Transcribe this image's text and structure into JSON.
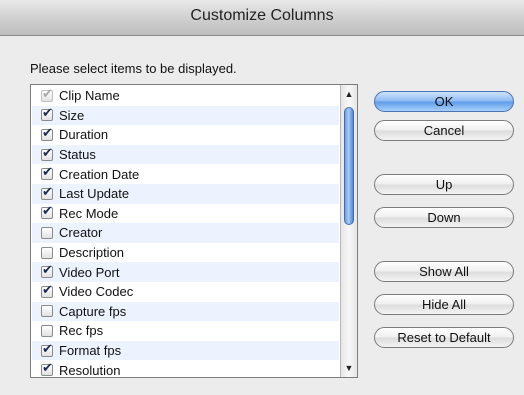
{
  "dialog": {
    "title": "Customize Columns",
    "prompt": "Please select items to be displayed."
  },
  "columns": [
    {
      "label": "Clip Name",
      "checked": true,
      "disabled": true
    },
    {
      "label": "Size",
      "checked": true,
      "disabled": false
    },
    {
      "label": "Duration",
      "checked": true,
      "disabled": false
    },
    {
      "label": "Status",
      "checked": true,
      "disabled": false
    },
    {
      "label": "Creation Date",
      "checked": true,
      "disabled": false
    },
    {
      "label": "Last Update",
      "checked": true,
      "disabled": false
    },
    {
      "label": "Rec Mode",
      "checked": true,
      "disabled": false
    },
    {
      "label": "Creator",
      "checked": false,
      "disabled": false
    },
    {
      "label": "Description",
      "checked": false,
      "disabled": false
    },
    {
      "label": "Video Port",
      "checked": true,
      "disabled": false
    },
    {
      "label": "Video Codec",
      "checked": true,
      "disabled": false
    },
    {
      "label": "Capture fps",
      "checked": false,
      "disabled": false
    },
    {
      "label": "Rec fps",
      "checked": false,
      "disabled": false
    },
    {
      "label": "Format fps",
      "checked": true,
      "disabled": false
    },
    {
      "label": "Resolution",
      "checked": true,
      "disabled": false
    }
  ],
  "buttons": {
    "ok": "OK",
    "cancel": "Cancel",
    "up": "Up",
    "down": "Down",
    "show_all": "Show All",
    "hide_all": "Hide All",
    "reset": "Reset to Default"
  },
  "icons": {
    "scroll_up": "scroll-up-arrow-icon",
    "scroll_down": "scroll-down-arrow-icon",
    "checkbox": "checkbox-icon"
  },
  "colors": {
    "default_button": "#6fa6ec",
    "row_stripe": "#edf3fe",
    "scroll_thumb": "#6f9edc"
  }
}
